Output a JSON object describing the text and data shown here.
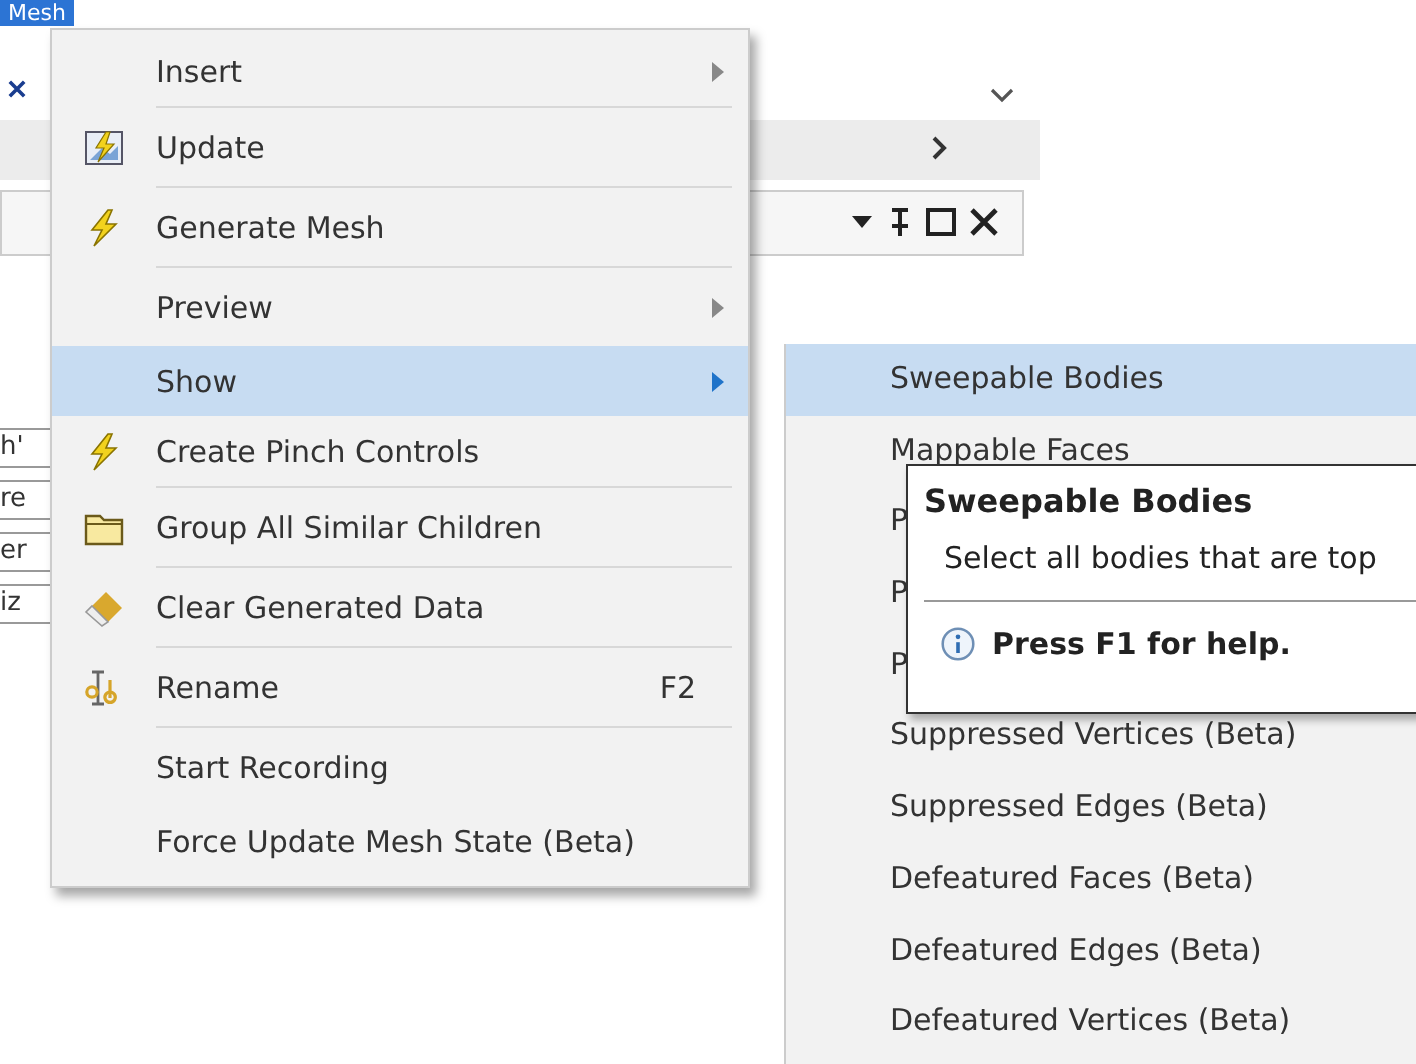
{
  "background": {
    "selected_node": "Mesh",
    "fragments": [
      "h'",
      "re",
      "er",
      "iz"
    ]
  },
  "context_menu": {
    "items": [
      {
        "label": "Insert",
        "kind": "plain",
        "submenu": true,
        "separator_above": false,
        "highlighted": false
      },
      {
        "label": "Update",
        "kind": "update",
        "submenu": false,
        "separator_above": true,
        "highlighted": false
      },
      {
        "label": "Generate Mesh",
        "kind": "bolt",
        "submenu": false,
        "separator_above": true,
        "highlighted": false
      },
      {
        "label": "Preview",
        "kind": "plain",
        "submenu": true,
        "separator_above": true,
        "highlighted": false
      },
      {
        "label": "Show",
        "kind": "plain",
        "submenu": true,
        "separator_above": false,
        "highlighted": true
      },
      {
        "label": "Create Pinch Controls",
        "kind": "bolt",
        "submenu": false,
        "separator_above": false,
        "highlighted": false
      },
      {
        "label": "Group All Similar Children",
        "kind": "folder",
        "submenu": false,
        "separator_above": true,
        "highlighted": false
      },
      {
        "label": "Clear Generated Data",
        "kind": "eraser",
        "submenu": false,
        "separator_above": true,
        "highlighted": false
      },
      {
        "label": "Rename",
        "kind": "rename",
        "submenu": false,
        "shortcut": "F2",
        "separator_above": true,
        "highlighted": false
      },
      {
        "label": "Start Recording",
        "kind": "plain",
        "submenu": false,
        "separator_above": true,
        "highlighted": false
      },
      {
        "label": "Force Update Mesh State (Beta)",
        "kind": "plain",
        "submenu": false,
        "separator_above": false,
        "highlighted": false
      }
    ]
  },
  "show_submenu": {
    "items": [
      {
        "label": "Sweepable Bodies",
        "highlighted": true
      },
      {
        "label": "Mappable Faces",
        "highlighted": false
      },
      {
        "label": "P",
        "highlighted": false
      },
      {
        "label": "P",
        "highlighted": false
      },
      {
        "label": "P",
        "highlighted": false
      },
      {
        "label": "Suppressed Vertices (Beta)",
        "highlighted": false
      },
      {
        "label": "Suppressed Edges (Beta)",
        "highlighted": false
      },
      {
        "label": "Defeatured Faces (Beta)",
        "highlighted": false
      },
      {
        "label": "Defeatured Edges (Beta)",
        "highlighted": false
      },
      {
        "label": "Defeatured Vertices (Beta)",
        "highlighted": false
      }
    ]
  },
  "tooltip": {
    "title": "Sweepable Bodies",
    "description": "Select all bodies that are top",
    "help": "Press F1 for help."
  }
}
